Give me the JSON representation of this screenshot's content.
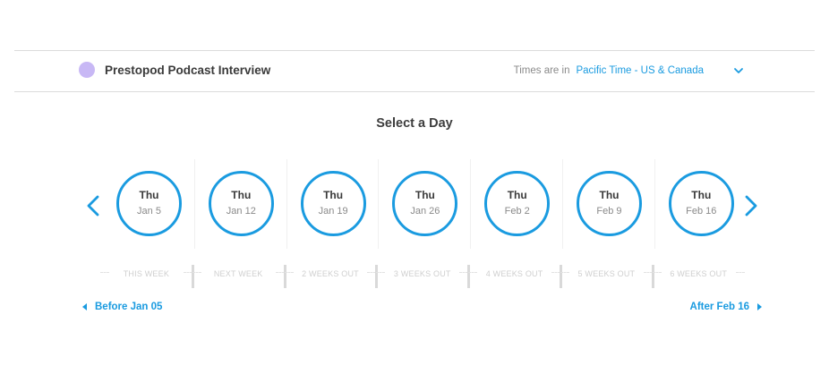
{
  "header": {
    "event_title": "Prestopod Podcast Interview",
    "event_color": "#c8b8f5",
    "timezone_label": "Times are in",
    "timezone_value": "Pacific Time - US & Canada",
    "timezone_icon": "chevron-down-icon"
  },
  "main": {
    "title": "Select a Day",
    "prev_icon": "chevron-left-icon",
    "next_icon": "chevron-right-icon",
    "days": [
      {
        "day": "Thu",
        "date": "Jan 5"
      },
      {
        "day": "Thu",
        "date": "Jan 12"
      },
      {
        "day": "Thu",
        "date": "Jan 19"
      },
      {
        "day": "Thu",
        "date": "Jan 26"
      },
      {
        "day": "Thu",
        "date": "Feb 2"
      },
      {
        "day": "Thu",
        "date": "Feb 9"
      },
      {
        "day": "Thu",
        "date": "Feb 16"
      }
    ],
    "weeks": [
      "THIS WEEK",
      "NEXT WEEK",
      "2 WEEKS OUT",
      "3 WEEKS OUT",
      "4 WEEKS OUT",
      "5 WEEKS OUT",
      "6 WEEKS OUT"
    ]
  },
  "footer": {
    "before_label": "Before Jan 05",
    "after_label": "After Feb 16"
  },
  "colors": {
    "accent": "#1a9be0",
    "text_dark": "#3a3a3a",
    "text_muted": "#8a8a8a"
  }
}
